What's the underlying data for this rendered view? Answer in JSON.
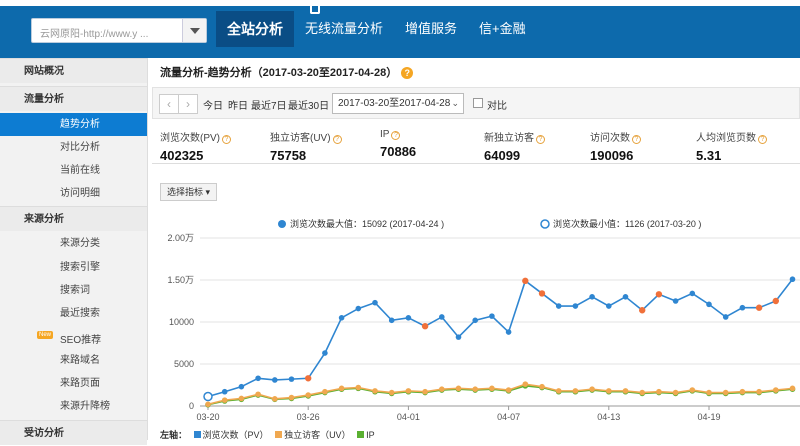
{
  "topbar": {
    "site_select_value": "云网原阳-http://www.y ...",
    "nav_tabs": [
      "全站分析",
      "无线流量分析",
      "增值服务",
      "信+金融"
    ]
  },
  "sidebar": {
    "overview": "网站概况",
    "traffic_group": "流量分析",
    "traffic_items": [
      "趋势分析",
      "对比分析",
      "当前在线",
      "访问明细"
    ],
    "source_group": "来源分析",
    "source_items": [
      "来源分类",
      "搜索引擎",
      "搜索词",
      "最近搜索",
      "SEO推荐",
      "来路域名",
      "来路页面",
      "来源升降榜"
    ],
    "new_badge": "New",
    "visit_group": "受访分析"
  },
  "page": {
    "title": "流量分析-趋势分析（2017-03-20至2017-04-28）",
    "help": "?"
  },
  "datebar": {
    "prev": "‹",
    "next": "›",
    "today": "今日",
    "yesterday": "昨日",
    "last7": "最近7日",
    "last30": "最近30日",
    "range": "2017-03-20至2017-04-28",
    "compare": "对比"
  },
  "metrics": [
    {
      "label": "浏览次数(PV)",
      "value": "402325"
    },
    {
      "label": "独立访客(UV)",
      "value": "75758"
    },
    {
      "label": "IP",
      "value": "70886"
    },
    {
      "label": "新独立访客",
      "value": "64099"
    },
    {
      "label": "访问次数",
      "value": "190096"
    },
    {
      "label": "人均浏览页数",
      "value": "5.31"
    }
  ],
  "select_metric": "选择指标 ▾",
  "chart_data": {
    "type": "line",
    "annotations": {
      "max": "浏览次数最大值：15092 (2017-04-24 )",
      "min": "浏览次数最小值：1126 (2017-03-20 )"
    },
    "y_ticks": [
      "0",
      "5000",
      "10000",
      "1.50万",
      "2.00万"
    ],
    "ylim": [
      0,
      20000
    ],
    "x_ticks": [
      "03-20",
      "03-26",
      "04-01",
      "04-07",
      "04-13",
      "04-19"
    ],
    "x": [
      "03-20",
      "03-21",
      "03-22",
      "03-23",
      "03-24",
      "03-25",
      "03-26",
      "03-27",
      "03-28",
      "03-29",
      "03-30",
      "03-31",
      "04-01",
      "04-02",
      "04-03",
      "04-04",
      "04-05",
      "04-06",
      "04-07",
      "04-08",
      "04-09",
      "04-10",
      "04-11",
      "04-12",
      "04-13",
      "04-14",
      "04-15",
      "04-16",
      "04-17",
      "04-18",
      "04-19",
      "04-20",
      "04-21",
      "04-22",
      "04-23",
      "04-24"
    ],
    "series": [
      {
        "name": "浏览次数（PV）",
        "color": "#2f86d1",
        "values": [
          1126,
          1700,
          2300,
          3300,
          3100,
          3200,
          3300,
          6300,
          10500,
          11600,
          12300,
          10200,
          10500,
          9500,
          10600,
          8200,
          10200,
          10700,
          8800,
          14900,
          13400,
          11900,
          11900,
          13000,
          11900,
          13000,
          11400,
          13300,
          12500,
          13400,
          12100,
          10600,
          11700,
          11700,
          12500,
          15092
        ]
      },
      {
        "name": "独立访客（UV）",
        "color": "#f0a850",
        "values": [
          200,
          700,
          900,
          1400,
          850,
          1000,
          1300,
          1700,
          2100,
          2200,
          1800,
          1600,
          1800,
          1700,
          2000,
          2100,
          2000,
          2100,
          1900,
          2600,
          2300,
          1800,
          1800,
          2000,
          1800,
          1800,
          1600,
          1700,
          1600,
          1900,
          1600,
          1600,
          1700,
          1700,
          1900,
          2100
        ]
      },
      {
        "name": "IP",
        "color": "#5ab031",
        "values": [
          150,
          600,
          800,
          1300,
          800,
          900,
          1200,
          1600,
          2000,
          2100,
          1700,
          1500,
          1700,
          1600,
          1900,
          2000,
          1900,
          2000,
          1800,
          2400,
          2200,
          1700,
          1700,
          1900,
          1700,
          1700,
          1500,
          1600,
          1500,
          1800,
          1500,
          1500,
          1600,
          1600,
          1800,
          2000
        ]
      }
    ],
    "footer_label": "左轴："
  }
}
